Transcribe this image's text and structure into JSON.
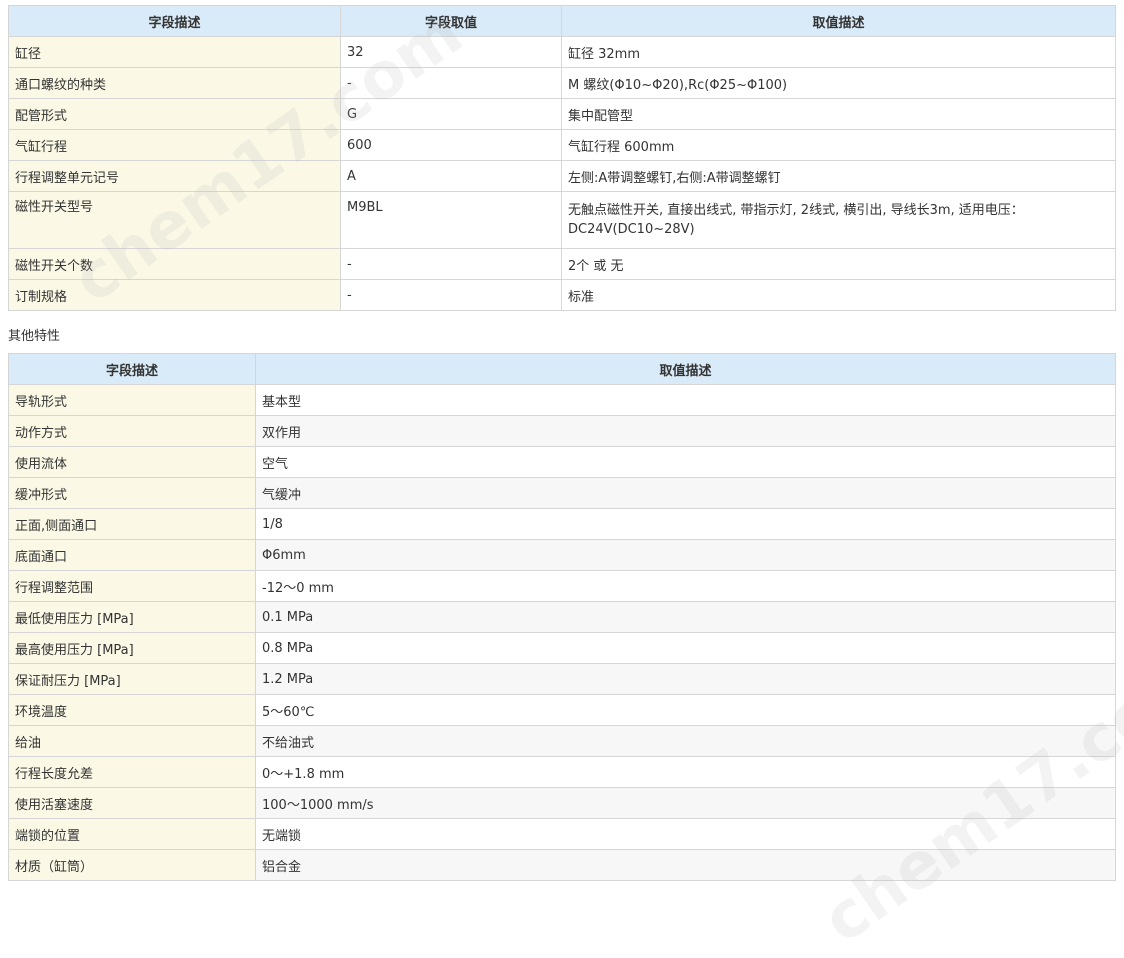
{
  "table1": {
    "headers": [
      "字段描述",
      "字段取值",
      "取值描述"
    ],
    "rows": [
      {
        "field": "缸径",
        "value": "32",
        "desc": "缸径 32mm"
      },
      {
        "field": "通口螺纹的种类",
        "value": "-",
        "desc": "M 螺纹(Φ10~Φ20),Rc(Φ25~Φ100)"
      },
      {
        "field": "配管形式",
        "value": "G",
        "desc": "集中配管型"
      },
      {
        "field": "气缸行程",
        "value": "600",
        "desc": "气缸行程 600mm"
      },
      {
        "field": "行程调整单元记号",
        "value": "A",
        "desc": "左侧:A带调整螺钉,右侧:A带调整螺钉"
      },
      {
        "field": "磁性开关型号",
        "value": "M9BL",
        "desc": "无触点磁性开关, 直接出线式, 带指示灯, 2线式, 横引出, 导线长3m, 适用电压：DC24V(DC10~28V)"
      },
      {
        "field": "磁性开关个数",
        "value": "-",
        "desc": "2个 或 无"
      },
      {
        "field": "订制规格",
        "value": "-",
        "desc": "标准"
      }
    ]
  },
  "section2_title": "其他特性",
  "table2": {
    "headers": [
      "字段描述",
      "取值描述"
    ],
    "rows": [
      {
        "field": "导轨形式",
        "desc": "基本型"
      },
      {
        "field": "动作方式",
        "desc": "双作用"
      },
      {
        "field": "使用流体",
        "desc": "空气"
      },
      {
        "field": "缓冲形式",
        "desc": "气缓冲"
      },
      {
        "field": "正面,侧面通口",
        "desc": "1/8"
      },
      {
        "field": "底面通口",
        "desc": "Φ6mm"
      },
      {
        "field": "行程调整范围",
        "desc": "-12～0 mm"
      },
      {
        "field": "最低使用压力 [MPa]",
        "desc": "0.1 MPa"
      },
      {
        "field": "最高使用压力 [MPa]",
        "desc": "0.8 MPa"
      },
      {
        "field": "保证耐压力 [MPa]",
        "desc": "1.2 MPa"
      },
      {
        "field": "环境温度",
        "desc": "5～60℃"
      },
      {
        "field": "给油",
        "desc": "不给油式"
      },
      {
        "field": "行程长度允差",
        "desc": "0～+1.8 mm"
      },
      {
        "field": "使用活塞速度",
        "desc": "100～1000 mm/s"
      },
      {
        "field": "端锁的位置",
        "desc": "无端锁"
      },
      {
        "field": "材质（缸筒）",
        "desc": "铝合金"
      }
    ]
  },
  "watermark": "chem17.com"
}
